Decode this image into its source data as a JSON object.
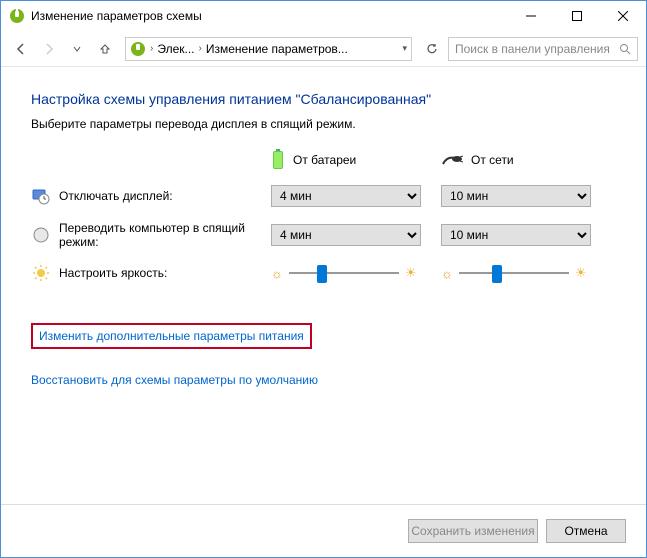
{
  "window": {
    "title": "Изменение параметров схемы"
  },
  "breadcrumb": {
    "item1": "Элек...",
    "item2": "Изменение параметров..."
  },
  "search": {
    "placeholder": "Поиск в панели управления"
  },
  "page": {
    "heading": "Настройка схемы управления питанием \"Сбалансированная\"",
    "subtext": "Выберите параметры перевода дисплея в спящий режим."
  },
  "columns": {
    "battery": "От батареи",
    "plugged": "От сети"
  },
  "rows": {
    "display_off": {
      "label": "Отключать дисплей:",
      "battery_value": "4 мин",
      "plugged_value": "10 мин"
    },
    "sleep": {
      "label": "Переводить компьютер в спящий режим:",
      "battery_value": "4 мин",
      "plugged_value": "10 мин"
    },
    "brightness": {
      "label": "Настроить яркость:",
      "battery_percent": 30,
      "plugged_percent": 35
    }
  },
  "links": {
    "advanced": "Изменить дополнительные параметры питания",
    "restore": "Восстановить для схемы параметры по умолчанию"
  },
  "buttons": {
    "save": "Сохранить изменения",
    "cancel": "Отмена"
  }
}
